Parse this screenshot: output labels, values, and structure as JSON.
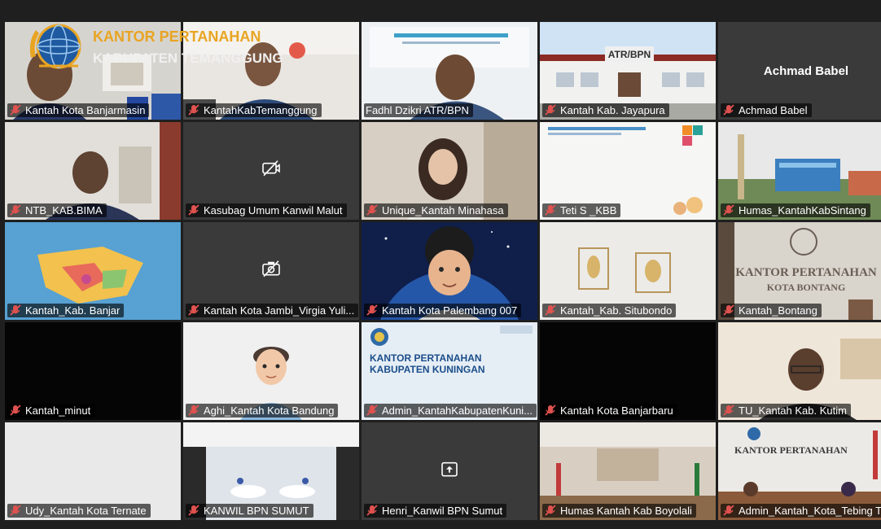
{
  "overlay": {
    "title": "KANTOR PERTANAHAN",
    "subtitle": "KABUPATEN TEMANGGUNG"
  },
  "tiles": [
    {
      "name": "Kantah Kota Banjarmasin"
    },
    {
      "name": "KantahKabTemanggung"
    },
    {
      "name": "Fadhl Dzikri ATR/BPN"
    },
    {
      "name": "Kantah Kab. Jayapura"
    },
    {
      "name": "Achmad Babel",
      "center": "Achmad Babel"
    },
    {
      "name": "NTB_KAB.BIMA"
    },
    {
      "name": "Kasubag Umum Kanwil Malut"
    },
    {
      "name": "Unique_Kantah Minahasa"
    },
    {
      "name": "Teti S _KBB"
    },
    {
      "name": "Humas_KantahKabSintang"
    },
    {
      "name": "Kantah_Kab. Banjar"
    },
    {
      "name": "Kantah Kota Jambi_Virgia Yuli..."
    },
    {
      "name": "Kantah Kota Palembang 007"
    },
    {
      "name": "Kantah_Kab. Situbondo"
    },
    {
      "name": "Kantah_Bontang"
    },
    {
      "name": "Kantah_minut"
    },
    {
      "name": "Aghi_Kantah Kota Bandung"
    },
    {
      "name": "Admin_KantahKabupatenKuni..."
    },
    {
      "name": "Kantah Kota Banjarbaru"
    },
    {
      "name": "TU_Kantah Kab. Kutim"
    },
    {
      "name": "Udy_Kantah Kota Ternate"
    },
    {
      "name": "KANWIL BPN SUMUT"
    },
    {
      "name": "Henri_Kanwil BPN Sumut"
    },
    {
      "name": "Humas Kantah Kab Boyolali"
    },
    {
      "name": "Admin_Kantah_Kota_Tebing T..."
    }
  ],
  "scene_text": {
    "atr_sign": "ATR/BPN",
    "kuningan_line1": "KANTOR PERTANAHAN",
    "kuningan_line2": "KABUPATEN KUNINGAN",
    "bontang_line1": "KANTOR PERTANAHAN",
    "bontang_line2": "KOTA BONTANG",
    "tebing_line1": "KANTOR PERTANAHAN"
  },
  "colors": {
    "active_border": "#7bd88f",
    "muted_mic": "#e0524f",
    "overlay_title": "#e9a422"
  }
}
